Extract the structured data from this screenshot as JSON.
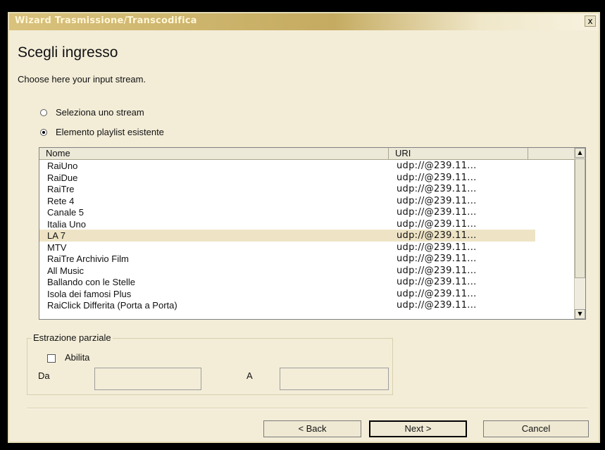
{
  "window": {
    "title": "Wizard Trasmissione/Transcodifica",
    "close_label": "x"
  },
  "page": {
    "heading": "Scegli ingresso",
    "subtitle": "Choose here your input stream."
  },
  "source_options": [
    {
      "label": "Seleziona uno stream",
      "checked": false
    },
    {
      "label": "Elemento playlist esistente",
      "checked": true
    }
  ],
  "playlist": {
    "columns": [
      "Nome",
      "URI"
    ],
    "rows": [
      {
        "name": "RaiUno",
        "uri": "udp://@239.11..."
      },
      {
        "name": "RaiDue",
        "uri": "udp://@239.11..."
      },
      {
        "name": "RaiTre",
        "uri": "udp://@239.11..."
      },
      {
        "name": "Rete 4",
        "uri": "udp://@239.11..."
      },
      {
        "name": "Canale 5",
        "uri": "udp://@239.11..."
      },
      {
        "name": "Italia Uno",
        "uri": "udp://@239.11..."
      },
      {
        "name": "LA 7",
        "uri": "udp://@239.11...",
        "selected": true
      },
      {
        "name": "MTV",
        "uri": "udp://@239.11..."
      },
      {
        "name": "RaiTre Archivio Film",
        "uri": "udp://@239.11..."
      },
      {
        "name": "All Music",
        "uri": "udp://@239.11..."
      },
      {
        "name": "Ballando con le Stelle",
        "uri": "udp://@239.11..."
      },
      {
        "name": "Isola dei famosi Plus",
        "uri": "udp://@239.11..."
      },
      {
        "name": "RaiClick Differita (Porta a Porta)",
        "uri": "udp://@239.11..."
      }
    ]
  },
  "partial": {
    "group_title": "Estrazione parziale",
    "enable_label": "Abilita",
    "enable_checked": false,
    "from_label": "Da",
    "to_label": "A",
    "from_value": "",
    "to_value": ""
  },
  "buttons": {
    "back": "< Back",
    "next": "Next >",
    "cancel": "Cancel"
  },
  "colors": {
    "dialog_bg": "#f3edd8",
    "titlebar_accent": "#c5ab61",
    "selection_bg": "#eee4c5"
  }
}
